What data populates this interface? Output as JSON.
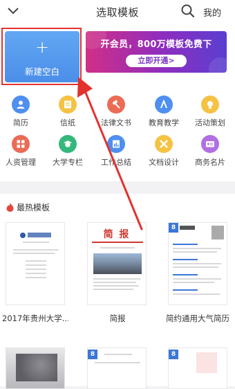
{
  "header": {
    "title": "选取模板",
    "mine": "我的"
  },
  "new_blank": {
    "plus": "+",
    "label": "新建空白"
  },
  "banner": {
    "text": "开会员，800万模板免费下",
    "button": "立即开通>"
  },
  "categories": [
    {
      "label": "简历",
      "icon": "person-icon",
      "color": "#4f8ff0"
    },
    {
      "label": "信纸",
      "icon": "letter-icon",
      "color": "#f5c244"
    },
    {
      "label": "法律文书",
      "icon": "gavel-icon",
      "color": "#ec6b55"
    },
    {
      "label": "教育教学",
      "icon": "ruler-icon",
      "color": "#4f8ff0"
    },
    {
      "label": "活动策划",
      "icon": "bulb-icon",
      "color": "#f5c244"
    },
    {
      "label": "人资管理",
      "icon": "grid-icon",
      "color": "#ec6b55"
    },
    {
      "label": "大学专栏",
      "icon": "cap-icon",
      "color": "#35b87a"
    },
    {
      "label": "工作总结",
      "icon": "chart-icon",
      "color": "#4f8ff0"
    },
    {
      "label": "文档设计",
      "icon": "pencil-icon",
      "color": "#f5c244"
    },
    {
      "label": "商务名片",
      "icon": "card-icon",
      "color": "#b070e0"
    }
  ],
  "hot": {
    "title": "最热模板",
    "templates": [
      {
        "name": "2017年贵州大学..."
      },
      {
        "name": "简报",
        "doc_title": "简 报"
      },
      {
        "name": "简约通用大气简历"
      }
    ],
    "badge": "8"
  },
  "colors": {
    "accent": "#4b8ee9",
    "highlight": "#e3312e",
    "arrow": "#e3312e"
  }
}
